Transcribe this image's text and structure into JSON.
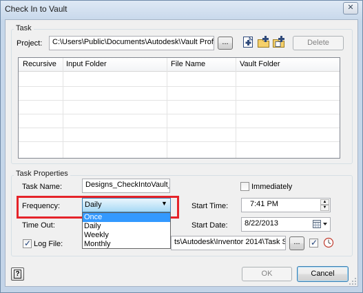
{
  "window": {
    "title": "Check In to Vault",
    "close_glyph": "✕"
  },
  "task": {
    "group_label": "Task",
    "project_label": "Project:",
    "project_value": "C:\\Users\\Public\\Documents\\Autodesk\\Vault Prof",
    "browse_label": "...",
    "delete_label": "Delete",
    "columns": [
      "Recursive",
      "Input Folder",
      "File Name",
      "Vault Folder"
    ]
  },
  "props": {
    "group_label": "Task Properties",
    "task_name_label": "Task Name:",
    "task_name_value": "Designs_CheckIntoVault_",
    "immediately_label": "Immediately",
    "frequency_label": "Frequency:",
    "frequency_value": "Daily",
    "frequency_options": [
      "Once",
      "Daily",
      "Weekly",
      "Monthly"
    ],
    "timeout_label": "Time Out:",
    "start_time_label": "Start Time:",
    "start_time_value": "7:41 PM",
    "start_date_label": "Start Date:",
    "start_date_value": "8/22/2013",
    "logfile_label": "Log File:",
    "logfile_value": "ts\\Autodesk\\Inventor 2014\\Task S",
    "logfile_browse_label": "..."
  },
  "footer": {
    "help_glyph": "?",
    "ok_label": "OK",
    "cancel_label": "Cancel"
  },
  "colors": {
    "highlight": "#e52329",
    "selection": "#3399ff"
  }
}
